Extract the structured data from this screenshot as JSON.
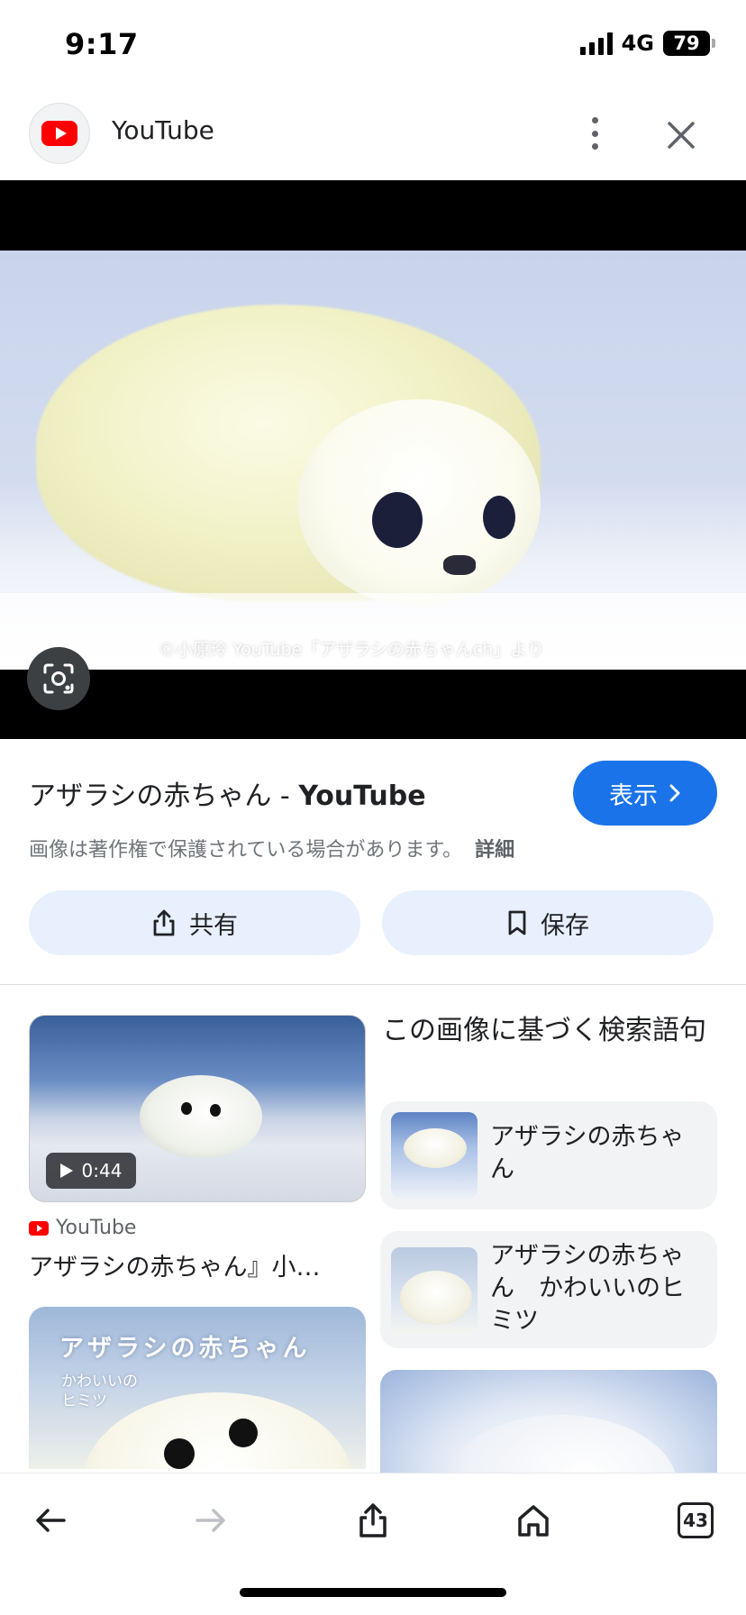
{
  "status_bar": {
    "time": "9:17",
    "network": "4G",
    "battery": "79"
  },
  "header": {
    "site_name": "YouTube"
  },
  "hero": {
    "watermark": "©小原玲 YouTube「アザラシの赤ちゃんch」より"
  },
  "result": {
    "title_jp": "アザラシの赤ちゃん - ",
    "title_site": "YouTube",
    "view_label": "表示",
    "copyright_notice": "画像は著作権で保護されている場合があります。",
    "detail_link": "詳細",
    "share_label": "共有",
    "save_label": "保存"
  },
  "left_results": {
    "video_duration": "0:44",
    "video_source": "YouTube",
    "video_caption": "アザラシの赤ちゃん』小…",
    "card2_title": "アザラシの赤ちゃん",
    "card2_subtitle": "かわいいの ヒミツ"
  },
  "right_results": {
    "heading": "この画像に基づく検索語句",
    "terms": [
      {
        "label": "アザラシの赤ちゃん"
      },
      {
        "label": "アザラシの赤ちゃん　かわいいのヒミツ"
      }
    ]
  },
  "bottom_nav": {
    "tab_count": "43"
  },
  "colors": {
    "accent": "#1a73e8",
    "pill_bg": "#e8f0fe",
    "youtube_red": "#ff0000"
  }
}
